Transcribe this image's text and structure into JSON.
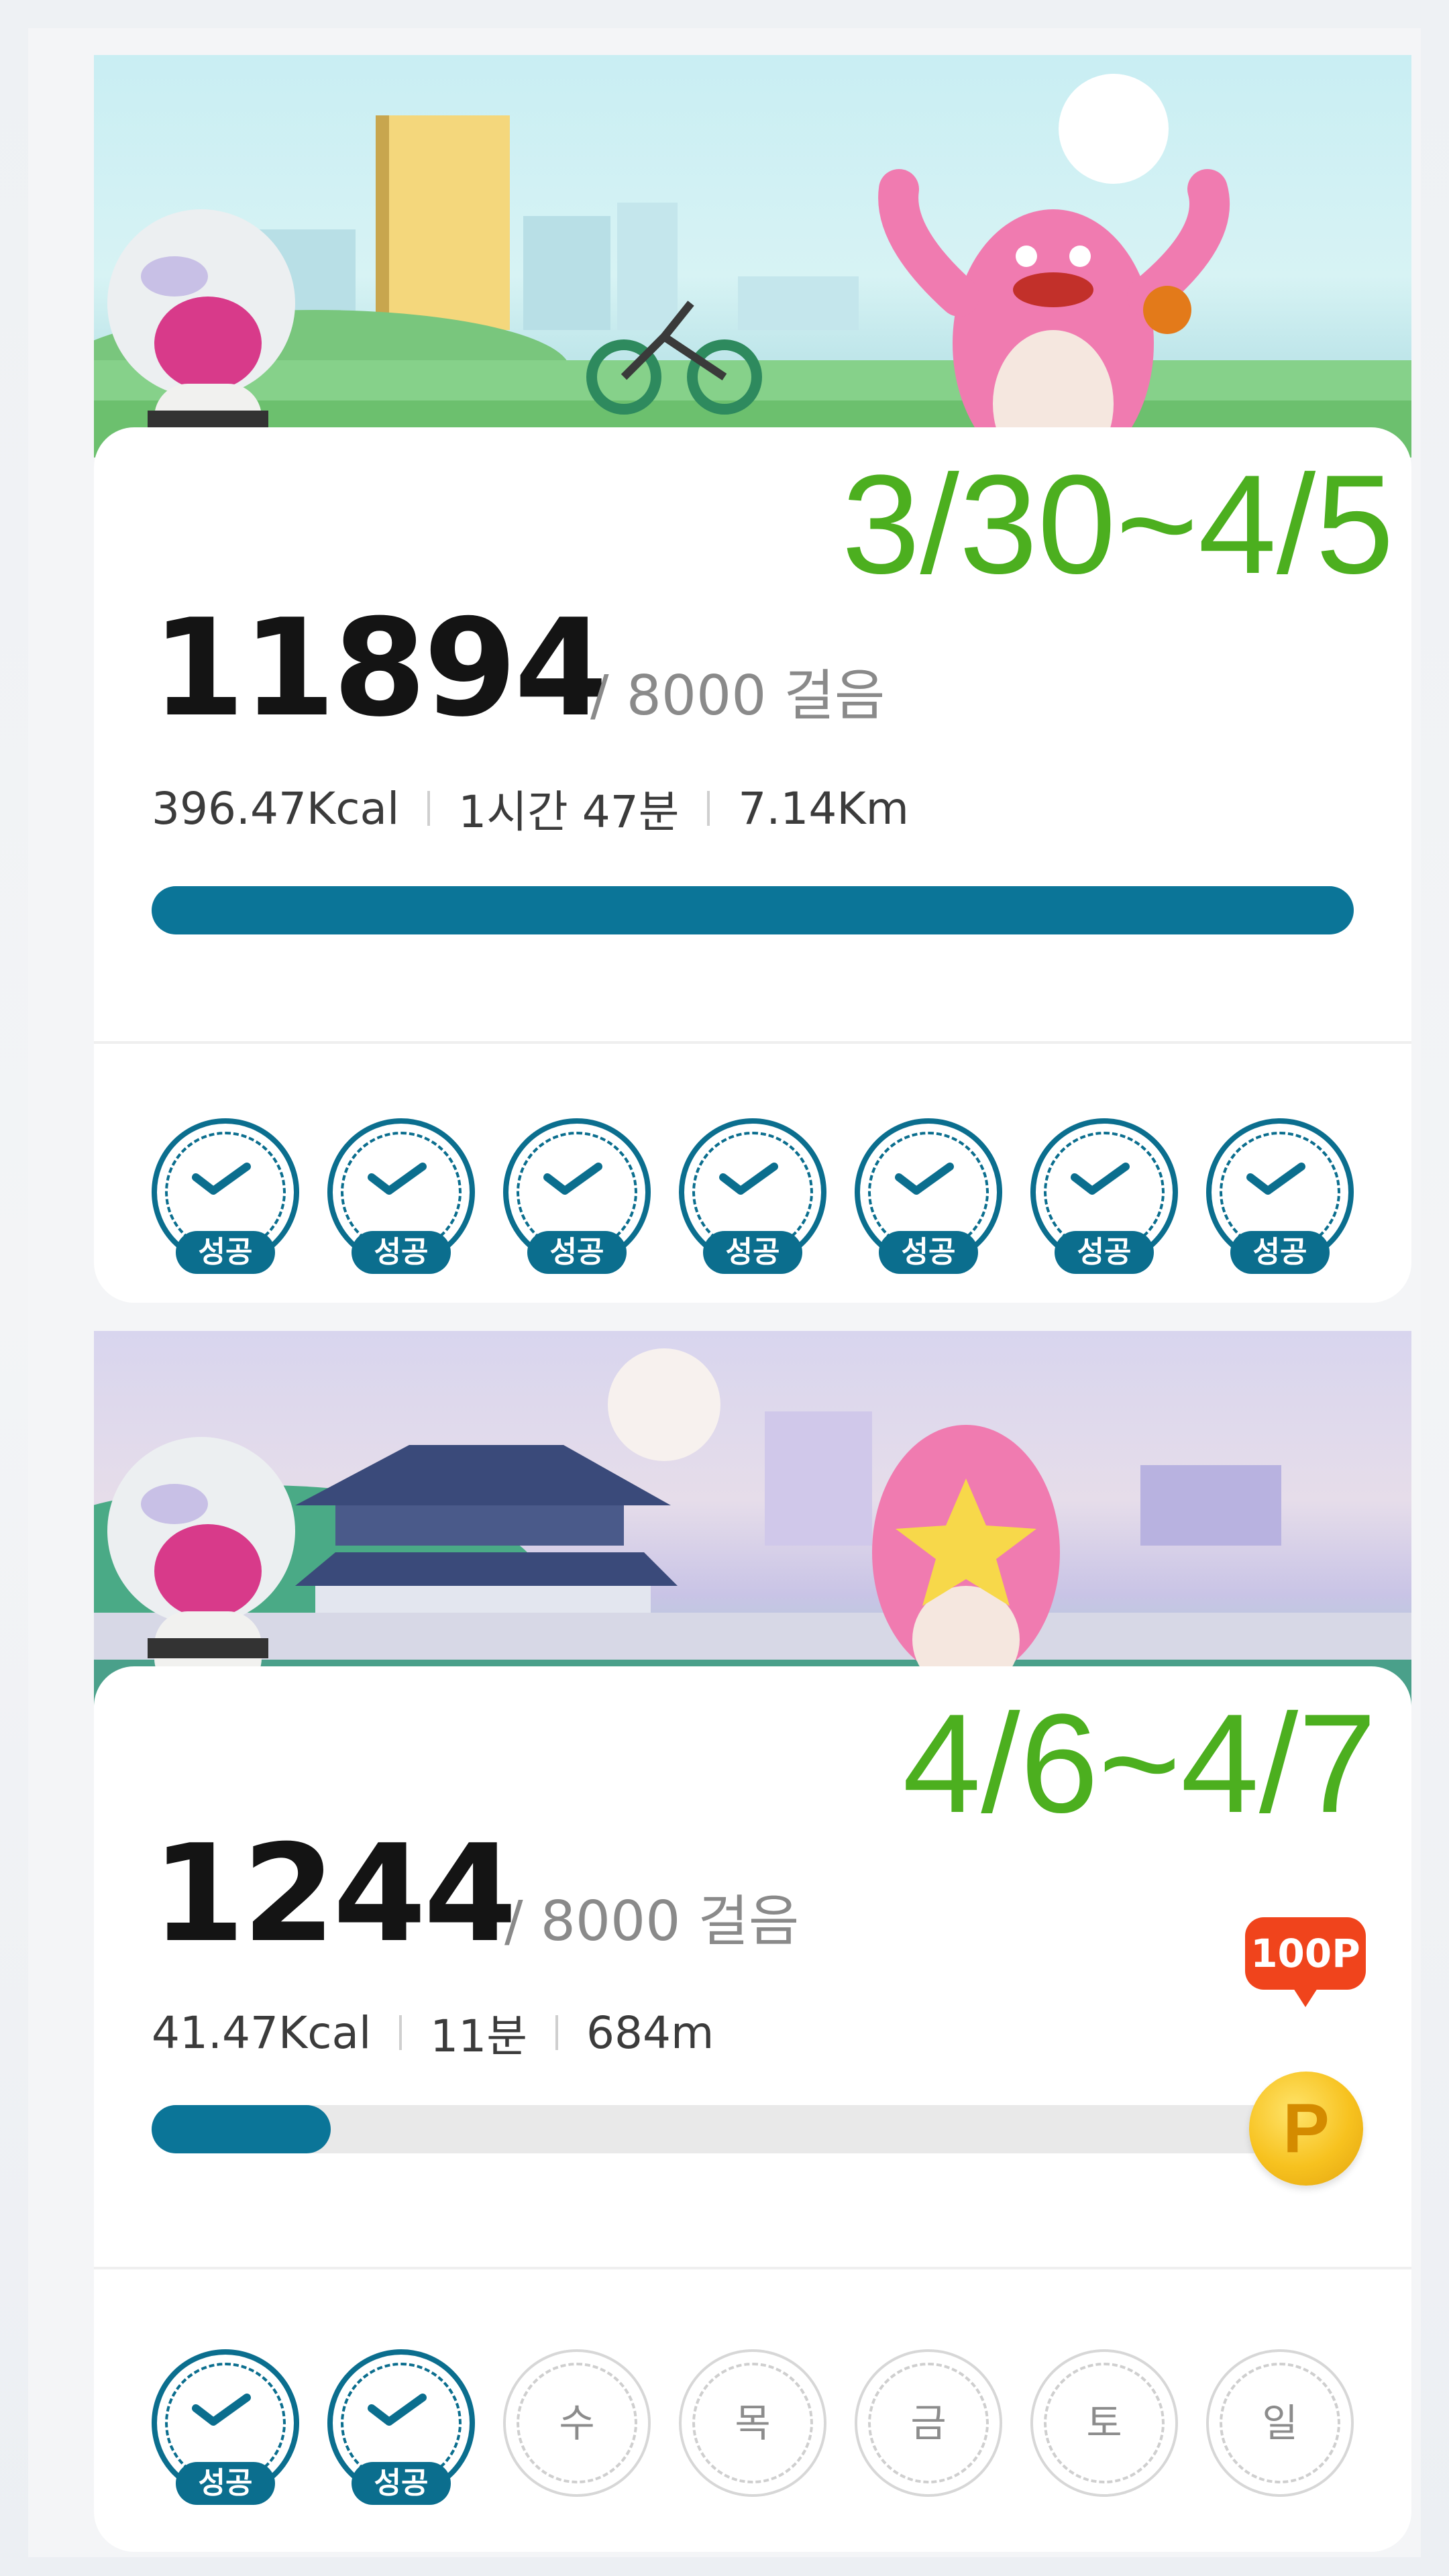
{
  "weeks": [
    {
      "date_range": "3/30~4/5",
      "steps": "11894",
      "goal": "/ 8000 걸음",
      "stats": {
        "calories": "396.47Kcal",
        "duration": "1시간 47분",
        "distance": "7.14Km"
      },
      "progress": 1.0,
      "days": [
        {
          "status": "done",
          "label": "성공"
        },
        {
          "status": "done",
          "label": "성공"
        },
        {
          "status": "done",
          "label": "성공"
        },
        {
          "status": "done",
          "label": "성공"
        },
        {
          "status": "done",
          "label": "성공"
        },
        {
          "status": "done",
          "label": "성공"
        },
        {
          "status": "done",
          "label": "성공"
        }
      ]
    },
    {
      "date_range": "4/6~4/7",
      "steps": "1244",
      "goal": "/ 8000 걸음",
      "stats": {
        "calories": "41.47Kcal",
        "duration": "11분",
        "distance": "684m"
      },
      "progress": 0.155,
      "reward": {
        "points": "100P",
        "coin_letter": "P"
      },
      "days": [
        {
          "status": "done",
          "label": "성공"
        },
        {
          "status": "done",
          "label": "성공"
        },
        {
          "status": "pending",
          "label": "수"
        },
        {
          "status": "pending",
          "label": "목"
        },
        {
          "status": "pending",
          "label": "금"
        },
        {
          "status": "pending",
          "label": "토"
        },
        {
          "status": "pending",
          "label": "일"
        }
      ]
    }
  ],
  "colors": {
    "accent": "#0b7598",
    "date_green": "#4caf1f",
    "reward_red": "#f0441c",
    "coin_gold": "#f7c21f"
  }
}
